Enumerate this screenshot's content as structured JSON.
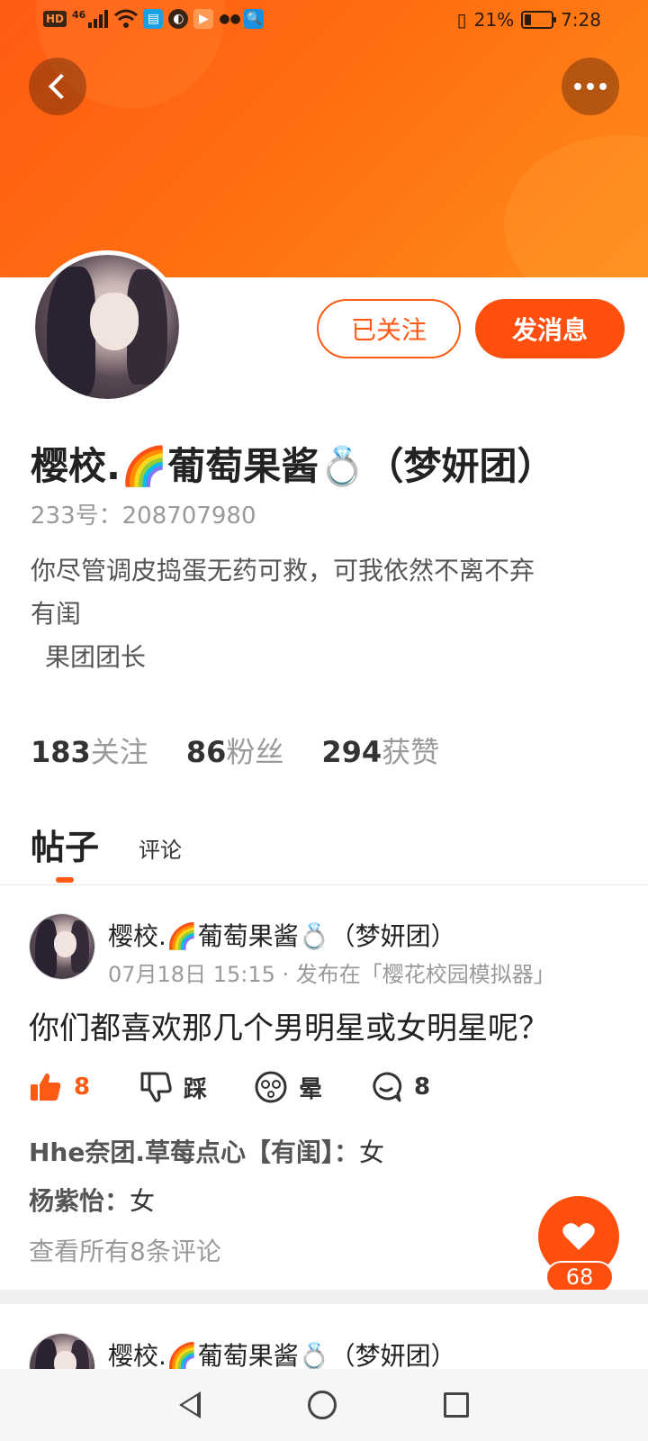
{
  "status_bar": {
    "network_badge": "HD",
    "signal_label": "46",
    "battery_percent": "21%",
    "time": "7:28"
  },
  "profile": {
    "name": "樱校.🌈葡萄果酱💍（梦妍团）",
    "uid": "233号：208707980",
    "bio_line1": "你尽管调皮捣蛋无药可救，可我依然不离不弃",
    "bio_line2": "有闺",
    "bio_line3": "果团团长",
    "follow_button": "已关注",
    "message_button": "发消息"
  },
  "stats": [
    {
      "value": "183",
      "label": "关注"
    },
    {
      "value": "86",
      "label": "粉丝"
    },
    {
      "value": "294",
      "label": "获赞"
    }
  ],
  "tabs": {
    "posts": "帖子",
    "comments": "评论"
  },
  "post": {
    "author": "樱校.🌈葡萄果酱💍（梦妍团）",
    "meta": "07月18日 15:15 · 发布在「樱花校园模拟器」",
    "text": "你们都喜欢那几个男明星或女明星呢？",
    "likes": "8",
    "dislike_label": "踩",
    "dizzy_label": "晕",
    "comment_count": "8",
    "comments": [
      {
        "user": "Hhe奈团.草莓点心【有闺】：",
        "text": "女"
      },
      {
        "user": "杨紫怡：",
        "text": "女"
      }
    ],
    "view_all": "查看所有8条评论"
  },
  "fab_count": "68",
  "post2": {
    "author": "樱校.🌈葡萄果酱💍（梦妍团）"
  },
  "colors": {
    "accent": "#ff5a14",
    "header_gradient_start": "#ff5a14",
    "header_gradient_end": "#ff8a1a"
  }
}
